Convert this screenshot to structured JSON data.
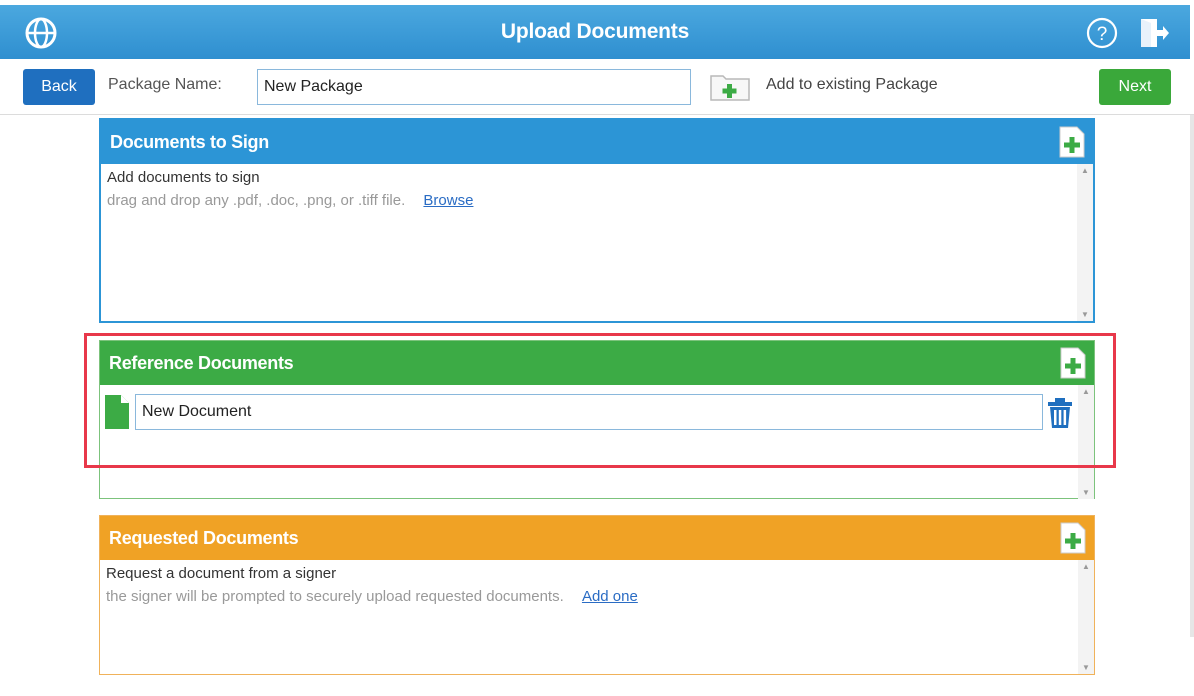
{
  "header": {
    "title": "Upload Documents",
    "logo_icon": "globe-logo-icon",
    "help_icon": "help-icon",
    "exit_icon": "exit-icon",
    "bg_color": "#3a9ad8"
  },
  "toolbar": {
    "back_label": "Back",
    "package_label": "Package Name:",
    "package_value": "New Package",
    "add_existing_label": "Add to existing Package",
    "add_existing_icon": "folder-add-icon",
    "next_label": "Next"
  },
  "panels": {
    "sign": {
      "title": "Documents to Sign",
      "line1": "Add documents to sign",
      "line2": "drag and drop any .pdf, .doc, .png, or .tiff file.",
      "link": "Browse",
      "color": "#2c95d6"
    },
    "reference": {
      "title": "Reference Documents",
      "doc_name": "New Document",
      "color": "#3cab45"
    },
    "requested": {
      "title": "Requested Documents",
      "line1": "Request a document from a signer",
      "line2": "the signer will be prompted to securely upload requested documents.",
      "link": "Add one",
      "color": "#f0a225"
    }
  },
  "highlight_color": "#e8384a"
}
